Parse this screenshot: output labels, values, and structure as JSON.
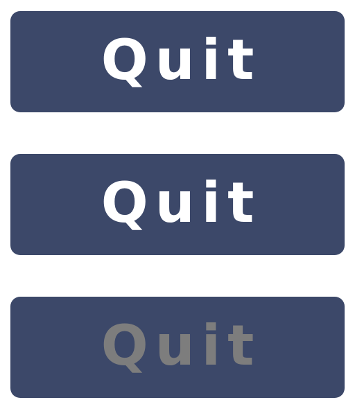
{
  "colors": {
    "button_bg": "#3c4869",
    "label_active": "#ffffff",
    "label_disabled": "#7d7d7d",
    "page_bg": "#ffffff"
  },
  "buttons": [
    {
      "state": "normal",
      "label": "Quit",
      "enabled": true
    },
    {
      "state": "hover",
      "label": "Quit",
      "enabled": true
    },
    {
      "state": "disabled",
      "label": "Quit",
      "enabled": false
    }
  ]
}
